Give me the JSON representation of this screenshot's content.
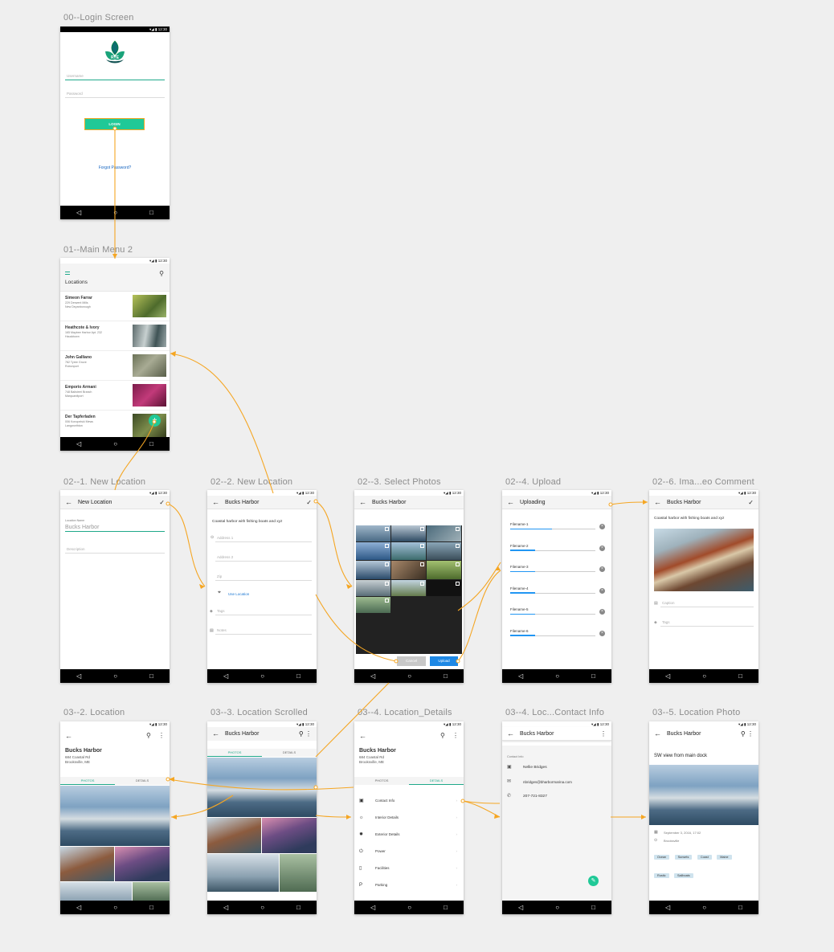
{
  "artboards": [
    {
      "id": "login",
      "label": "00--Login Screen"
    },
    {
      "id": "main",
      "label": "01--Main Menu 2"
    },
    {
      "id": "newloc",
      "label": "02--1. New Location"
    },
    {
      "id": "newloc2",
      "label": "02--2. New Location"
    },
    {
      "id": "select",
      "label": "02--3. Select Photos"
    },
    {
      "id": "upload",
      "label": "02--4. Upload"
    },
    {
      "id": "comment",
      "label": "02--6. Ima...eo Comment"
    },
    {
      "id": "location",
      "label": "03--2. Location"
    },
    {
      "id": "scrolled",
      "label": "03--3. Location Scrolled"
    },
    {
      "id": "details",
      "label": "03--4. Location_Details"
    },
    {
      "id": "contact",
      "label": "03--4. Loc...Contact Info"
    },
    {
      "id": "photo",
      "label": "03--5. Location Photo"
    }
  ],
  "status": {
    "time": "12:30",
    "icons": "▾◢ ▮"
  },
  "nav": {
    "back": "◁",
    "home": "○",
    "recent": "□"
  },
  "login": {
    "logo_text": "RYE",
    "username_placeholder": "Username",
    "password_placeholder": "Password",
    "login_button": "LOGIN",
    "forgot": "Forgot Password?"
  },
  "main": {
    "title": "Locations",
    "items": [
      {
        "name": "Simeon Farrar",
        "addr": "229 Derwent Mills\nNew Deyanborough"
      },
      {
        "name": "Heathcote & Ivory",
        "addr": "165 Maybee Harbor Apt. 232\nHaucktown"
      },
      {
        "name": "John Galliano",
        "addr": "782 Tyree Grove\nRobonport"
      },
      {
        "name": "Emporio Armani",
        "addr": "748 Balistreri Branch\nMarquardtport"
      },
      {
        "name": "Der Tapferladen",
        "addr": "006 Konopelski Mews\nLangworthton"
      }
    ],
    "fab": "+"
  },
  "newloc": {
    "title": "New Location",
    "field_label": "Location Name",
    "field_value": "Bucks Harbor",
    "desc_placeholder": "Description"
  },
  "newloc2": {
    "title": "Bucks Harbor",
    "desc": "Coastal harbor with fishing boats and xyz",
    "address1": "Address 1",
    "address2": "Address 2",
    "zip": "Zip",
    "use_location": "Use Location",
    "tags": "Tags",
    "notes": "Notes"
  },
  "select": {
    "title": "Bucks Harbor",
    "cancel": "Cancel",
    "upload": "Upload"
  },
  "upload": {
    "title": "Uploading",
    "files": [
      {
        "name": "Filename-1",
        "progress": 0.5
      },
      {
        "name": "Filename-2",
        "progress": 0.3
      },
      {
        "name": "Filename-3",
        "progress": 0.3
      },
      {
        "name": "Filename-4",
        "progress": 0.3
      },
      {
        "name": "Filename-5",
        "progress": 0.3
      },
      {
        "name": "Filename-6",
        "progress": 0.3
      }
    ]
  },
  "comment": {
    "title": "Bucks Harbor",
    "desc": "Coastal harbor with fishing boats and xyz",
    "caption": "Caption",
    "tags": "Tags"
  },
  "location": {
    "title": "Bucks Harbor",
    "addr1": "684 Coastal Rd",
    "addr2": "Brooksville, ME",
    "tab_photos": "PHOTOS",
    "tab_details": "DETAILS"
  },
  "scrolled": {
    "title": "Bucks Harbor",
    "tab_photos": "PHOTOS",
    "tab_details": "DETAILS"
  },
  "details": {
    "title": "Bucks Harbor",
    "addr1": "684 Coastal Rd",
    "addr2": "Brooksville, ME",
    "tab_photos": "PHOTOS",
    "tab_details": "DETAILS",
    "rows": [
      {
        "label": "Contact Info",
        "icon": "contact-card-icon"
      },
      {
        "label": "Interior Details",
        "icon": "lightbulb-icon"
      },
      {
        "label": "Exterior Details",
        "icon": "sun-icon"
      },
      {
        "label": "Power",
        "icon": "plug-icon"
      },
      {
        "label": "Facilities",
        "icon": "door-icon"
      },
      {
        "label": "Parking",
        "icon": "parking-icon"
      }
    ]
  },
  "contact": {
    "title": "Bucks Harbor",
    "section": "Contact Info",
    "name": "Nellie Bridges",
    "email": "nbridges@bharbormarina.com",
    "phone": "207-721-8327"
  },
  "photo": {
    "title": "Bucks Harbor",
    "caption": "SW view from main dock",
    "date": "September 3, 2016, 17:02",
    "place": "Brooksville",
    "tags": [
      "Ocean",
      "Sunsets",
      "Coast",
      "Maine",
      "Rustic",
      "Sailboats"
    ]
  }
}
